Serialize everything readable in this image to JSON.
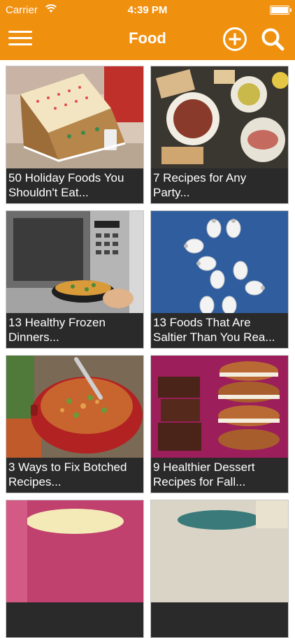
{
  "status_bar": {
    "carrier": "Carrier",
    "time": "4:39 PM"
  },
  "nav": {
    "title": "Food",
    "menu_icon": "hamburger-menu-icon",
    "add_icon": "plus-circle-icon",
    "search_icon": "search-icon"
  },
  "colors": {
    "header_bg": "#f0900f",
    "caption_bg": "#2a2a2a"
  },
  "articles": [
    {
      "title": "50 Holiday Foods You Shouldn't Eat..."
    },
    {
      "title": "7 Recipes for Any Party..."
    },
    {
      "title": "13 Healthy Frozen Dinners..."
    },
    {
      "title": "13 Foods That Are Saltier Than You Rea..."
    },
    {
      "title": "3 Ways to Fix Botched Recipes..."
    },
    {
      "title": "9 Healthier Dessert Recipes for Fall..."
    },
    {
      "title": ""
    },
    {
      "title": ""
    }
  ]
}
